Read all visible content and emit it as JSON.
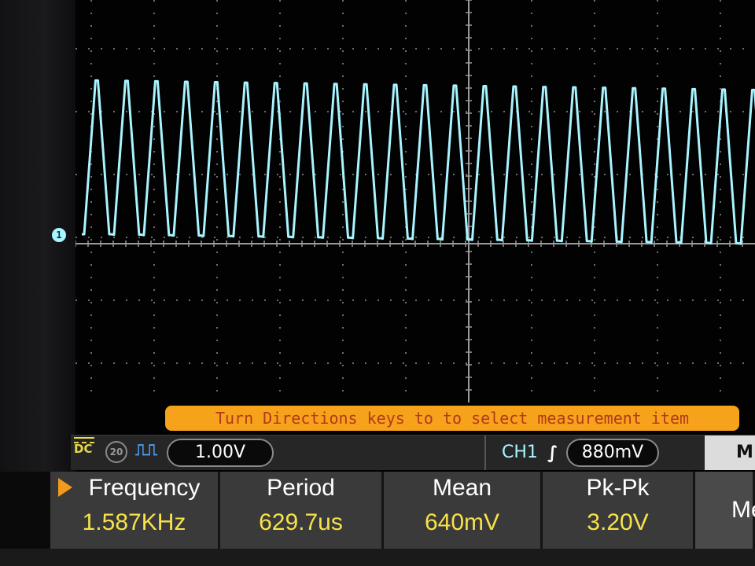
{
  "screen": {
    "channel_marker": "1",
    "trace_color": "#a8f4ff",
    "grid_color": "#6e6e6e",
    "hint_text": "Turn Directions keys to to select measurement item"
  },
  "status_bar": {
    "coupling": "DC",
    "bandwidth_limit": "20",
    "wave_icon": "square-wave-icon",
    "volts_per_div": "1.00V",
    "trigger_channel": "CH1",
    "trigger_edge_icon": "rising-edge-icon",
    "trigger_level": "880mV",
    "menu_tab": "M"
  },
  "measurements": [
    {
      "label": "Frequency",
      "value": "1.587KHz"
    },
    {
      "label": "Period",
      "value": "629.7us"
    },
    {
      "label": "Mean",
      "value": "640mV"
    },
    {
      "label": "Pk-Pk",
      "value": "3.20V"
    },
    {
      "label": "Me",
      "value": ""
    }
  ],
  "waveform": {
    "cycles_visible": 22.5,
    "pk_pk_volts": 3.2,
    "baseline_volts": 0.0,
    "volts_per_div": 1.0
  }
}
